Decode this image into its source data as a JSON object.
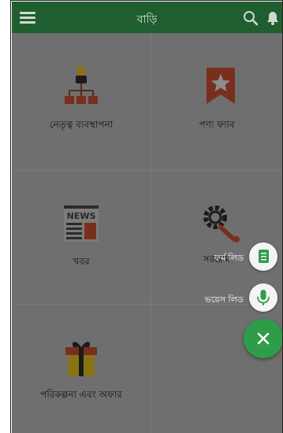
{
  "appbar": {
    "title": "বাড়ি"
  },
  "tiles": [
    {
      "label": "নেতৃত্ব ব্যবস্থাপনা",
      "icon": "hierarchy-icon"
    },
    {
      "label": "পণ্য ফ্যাব",
      "icon": "star-ribbon-icon"
    },
    {
      "label": "খবর",
      "icon": "news-icon"
    },
    {
      "label": "সরঞ্জাম",
      "icon": "wrench-gear-icon"
    },
    {
      "label": "পরিকল্পনা এবং অফার",
      "icon": "gift-icon"
    }
  ],
  "fab_menu": {
    "form_label": "ফর্ম লিড",
    "voice_label": "ভয়েস লিড"
  },
  "colors": {
    "appbar": "#1f5e2e",
    "fab_main": "#2e9d4a",
    "overlay": "#6a6a6a"
  }
}
